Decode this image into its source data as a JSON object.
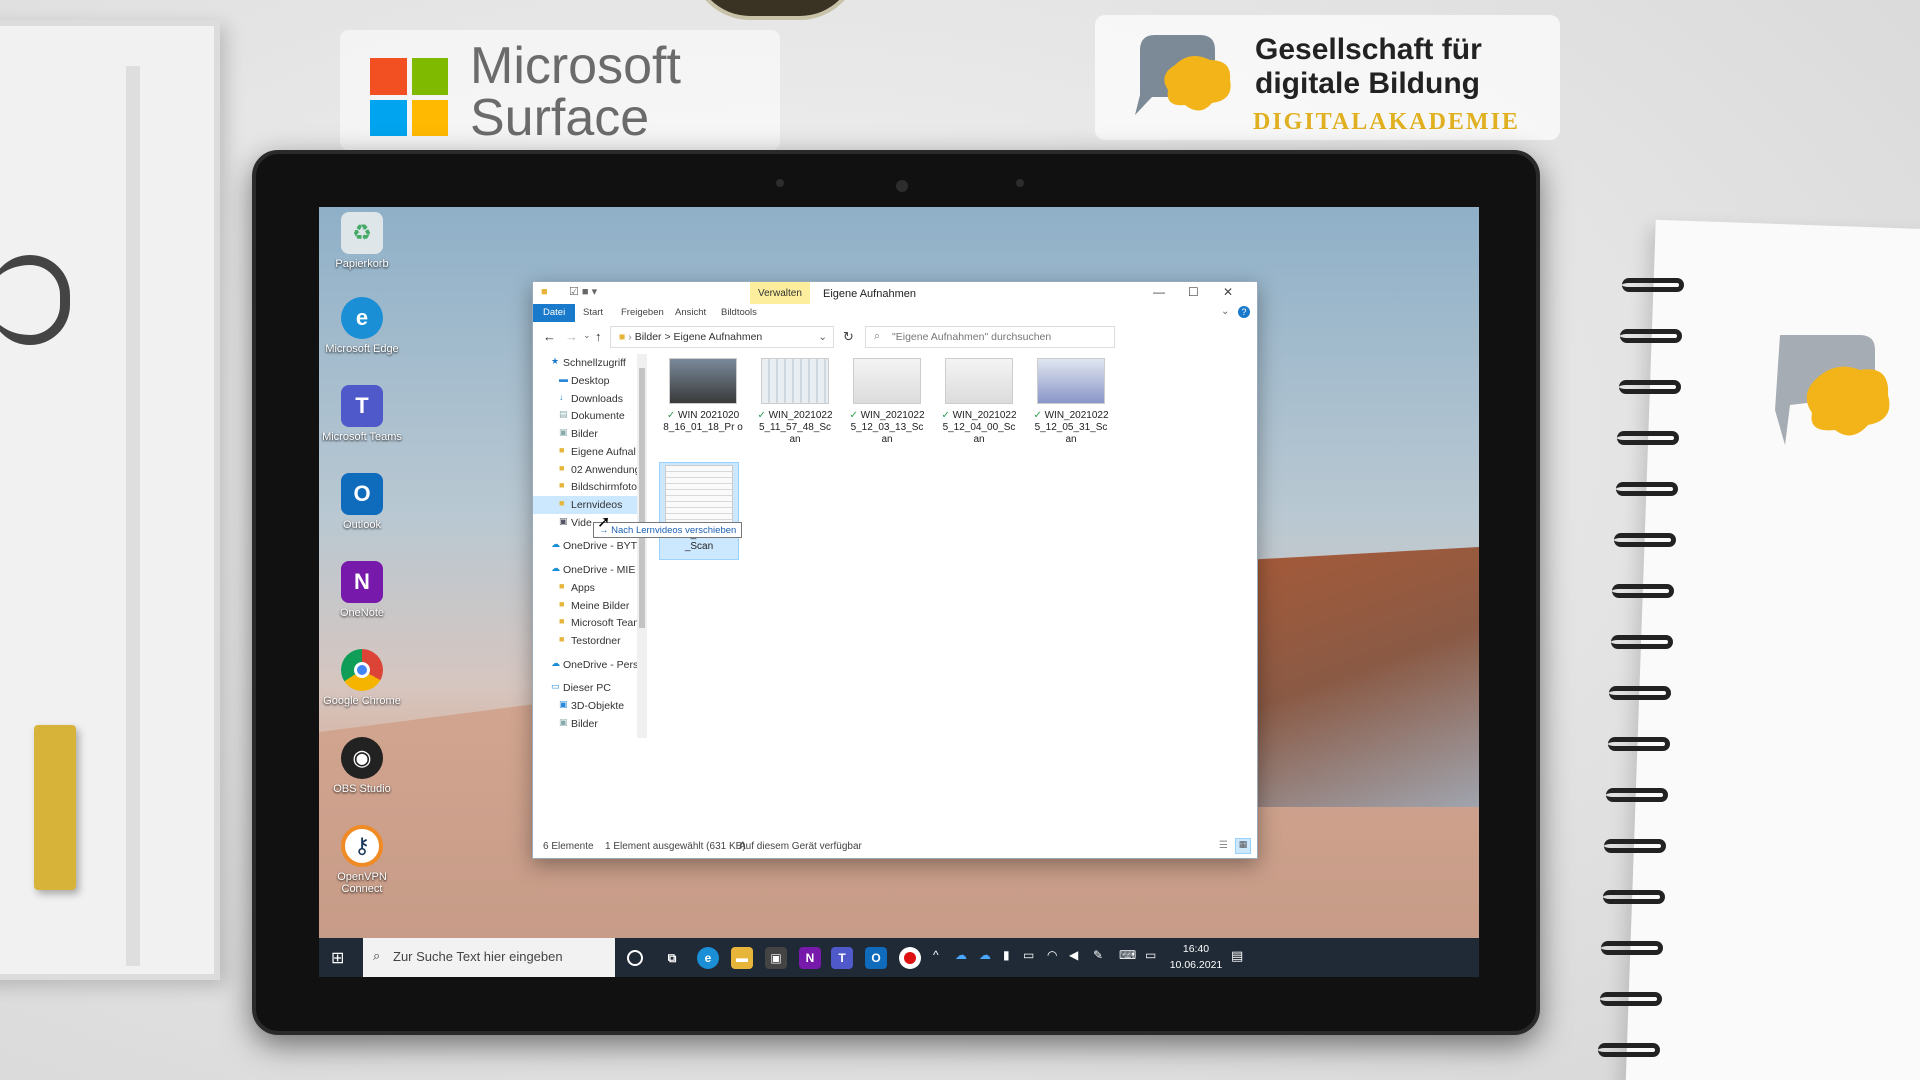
{
  "branding": {
    "ms_name_line1": "Microsoft",
    "ms_name_line2": "Surface",
    "gdb_line1": "Gesellschaft für",
    "gdb_line2": "digitale Bildung",
    "gdb_line3": "DIGITALAKADEMIE",
    "colors": {
      "accent": "#1979ca",
      "gold": "#e0b020"
    }
  },
  "desktop": {
    "icons": [
      {
        "label": "Papierkorb",
        "icon": "recycle-bin-icon"
      },
      {
        "label": "Microsoft Edge",
        "icon": "edge-icon"
      },
      {
        "label": "Microsoft Teams",
        "icon": "teams-icon"
      },
      {
        "label": "Outlook",
        "icon": "outlook-icon"
      },
      {
        "label": "OneNote",
        "icon": "onenote-icon"
      },
      {
        "label": "Google Chrome",
        "icon": "chrome-icon"
      },
      {
        "label": "OBS Studio",
        "icon": "obs-icon"
      },
      {
        "label": "OpenVPN Connect",
        "icon": "openvpn-icon"
      }
    ]
  },
  "explorer": {
    "verwalten": "Verwalten",
    "title": "Eigene Aufnahmen",
    "ribbon": {
      "file": "Datei",
      "start": "Start",
      "share": "Freigeben",
      "view": "Ansicht",
      "tools": "Bildtools"
    },
    "address": {
      "part1": "Bilder",
      "sep": ">",
      "part2": "Eigene Aufnahmen"
    },
    "search_placeholder": "\"Eigene Aufnahmen\" durchsuchen",
    "nav": [
      "Schnellzugriff",
      "Desktop",
      "Downloads",
      "Dokumente",
      "Bilder",
      "Eigene Aufnal",
      "02 Anwendung",
      "Bildschirmfotos",
      "Lernvideos",
      "Vide",
      "OneDrive - BYTECI",
      "OneDrive - MIE Ar",
      "Apps",
      "Meine Bilder",
      "Microsoft Teams",
      "Testordner",
      "OneDrive - Person",
      "Dieser PC",
      "3D-Objekte",
      "Bilder"
    ],
    "files": [
      {
        "name": "WIN 2021020 8_16_01_18_Pr o"
      },
      {
        "name": "WIN_2021022 5_11_57_48_Sc an"
      },
      {
        "name": "WIN_2021022 5_12_03_13_Sc an"
      },
      {
        "name": "WIN_2021022 5_12_04_00_Sc an"
      },
      {
        "name": "WIN_2021022 5_12_05_31_Sc an"
      },
      {
        "name": "WIN_20210 15_Scan"
      }
    ],
    "tooltip": "→ Nach Lernvideos verschieben",
    "status": {
      "count": "6 Elemente",
      "selection": "1 Element ausgewählt (631 KB)",
      "availability": "Auf diesem Gerät verfügbar"
    }
  },
  "taskbar": {
    "search_placeholder": "Zur Suche Text hier eingeben",
    "time": "16:40",
    "date": "10.06.2021"
  }
}
